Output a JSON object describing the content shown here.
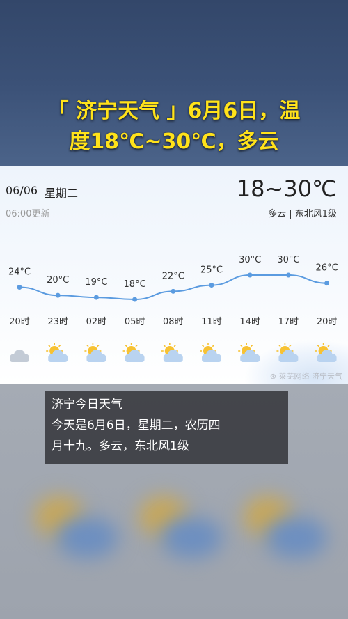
{
  "headline": {
    "line1": "「 济宁天气 」6月6日，温",
    "line2": "度18℃~30℃，多云"
  },
  "card": {
    "date": "06/06",
    "weekday": "星期二",
    "updated": "06:00更新",
    "temp_range": "18~30℃",
    "condition": "多云 | 东北风1级",
    "watermark": "⊛ 莱芜网络 济宁天气"
  },
  "chart_data": {
    "type": "line",
    "x": [
      "20时",
      "23时",
      "02时",
      "05时",
      "08时",
      "11时",
      "14时",
      "17时",
      "20时"
    ],
    "temp_labels": [
      "24°C",
      "20°C",
      "19°C",
      "18°C",
      "22°C",
      "25°C",
      "30°C",
      "30°C",
      "26°C"
    ],
    "series": [
      {
        "values": [
          24,
          20,
          19,
          18,
          22,
          25,
          30,
          30,
          26
        ]
      }
    ],
    "ylim": [
      18,
      30
    ],
    "line_color": "#5b9be0",
    "icons": [
      "cloudy-night-icon",
      "partly-cloudy-icon",
      "partly-cloudy-icon",
      "partly-cloudy-icon",
      "partly-cloudy-icon",
      "partly-cloudy-icon",
      "partly-cloudy-icon",
      "partly-cloudy-icon",
      "partly-cloudy-icon"
    ]
  },
  "caption": {
    "line1": "济宁今日天气",
    "line2": "今天是6月6日，星期二，农历四",
    "line3": "月十九。多云，东北风1级"
  }
}
